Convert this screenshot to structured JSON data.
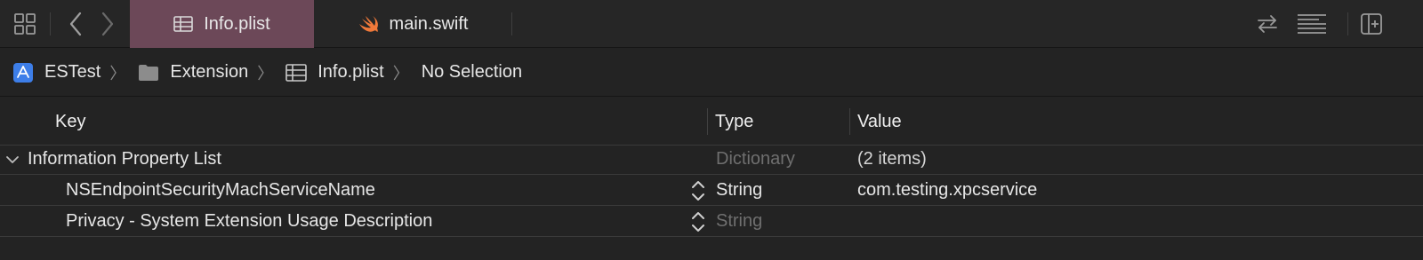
{
  "tabbar": {
    "tabs": [
      {
        "label": "Info.plist",
        "icon": "plist-table-icon",
        "active": true
      },
      {
        "label": "main.swift",
        "icon": "swift-icon",
        "active": false
      }
    ]
  },
  "jumpbar": {
    "crumbs": [
      {
        "label": "ESTest",
        "icon": "xcode-project-icon"
      },
      {
        "label": "Extension",
        "icon": "folder-icon"
      },
      {
        "label": "Info.plist",
        "icon": "plist-table-icon"
      },
      {
        "label": "No Selection",
        "icon": ""
      }
    ]
  },
  "table": {
    "headers": {
      "key": "Key",
      "type": "Type",
      "value": "Value"
    },
    "rows": [
      {
        "key": "Information Property List",
        "type": "Dictionary",
        "value": "(2 items)",
        "expanded": true
      },
      {
        "key": "NSEndpointSecurityMachServiceName",
        "type": "String",
        "value": "com.testing.xpcservice"
      },
      {
        "key": "Privacy - System Extension Usage Description",
        "type": "String",
        "value": ""
      }
    ]
  },
  "colors": {
    "active_tab": "#6c4858",
    "background": "#232323",
    "swift_orange": "#f0793a",
    "project_blue": "#3d7ee8"
  }
}
